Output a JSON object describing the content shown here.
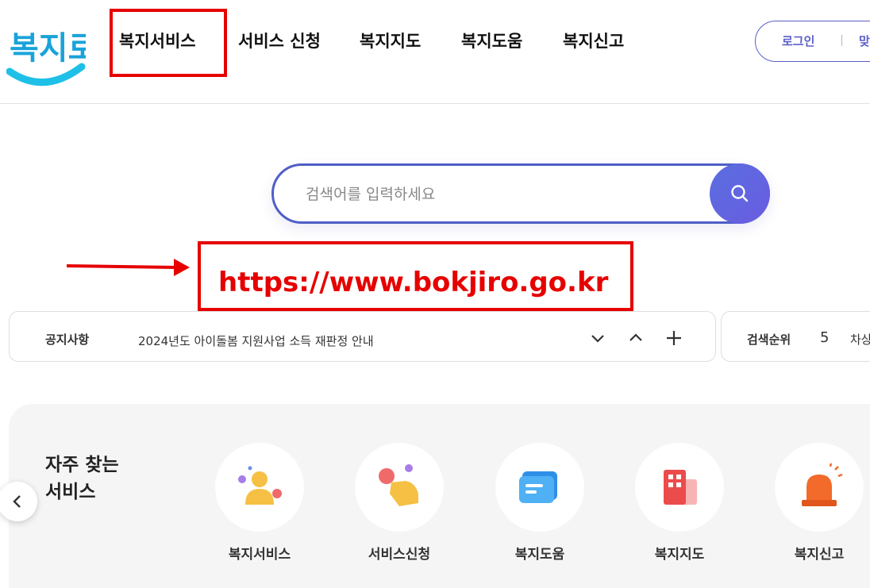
{
  "logo": {
    "text": "복지로"
  },
  "nav": {
    "items": [
      "복지서비스",
      "서비스 신청",
      "복지지도",
      "복지도움",
      "복지신고"
    ]
  },
  "util": {
    "login": "로그인",
    "join": "맞"
  },
  "search": {
    "placeholder": "검색어를 입력하세요"
  },
  "annotation": {
    "url": "https://www.bokjiro.go.kr",
    "color": "#e60000"
  },
  "notice": {
    "label": "공지사항",
    "text": "2024년도 아이돌봄 지원사업 소득 재판정 안내"
  },
  "rank": {
    "label": "검색순위",
    "number": "5",
    "word": "차상"
  },
  "frequent": {
    "title_line1": "자주 찾는",
    "title_line2": "서비스",
    "items": [
      {
        "label": "복지서비스",
        "icon": "person-icon"
      },
      {
        "label": "서비스신청",
        "icon": "hand-touch-icon"
      },
      {
        "label": "복지도움",
        "icon": "chat-card-icon"
      },
      {
        "label": "복지지도",
        "icon": "building-icon"
      },
      {
        "label": "복지신고",
        "icon": "siren-icon"
      }
    ]
  },
  "colors": {
    "accent": "#5a5fc8",
    "brand": "#1aa3d9",
    "highlight": "#e60000"
  }
}
